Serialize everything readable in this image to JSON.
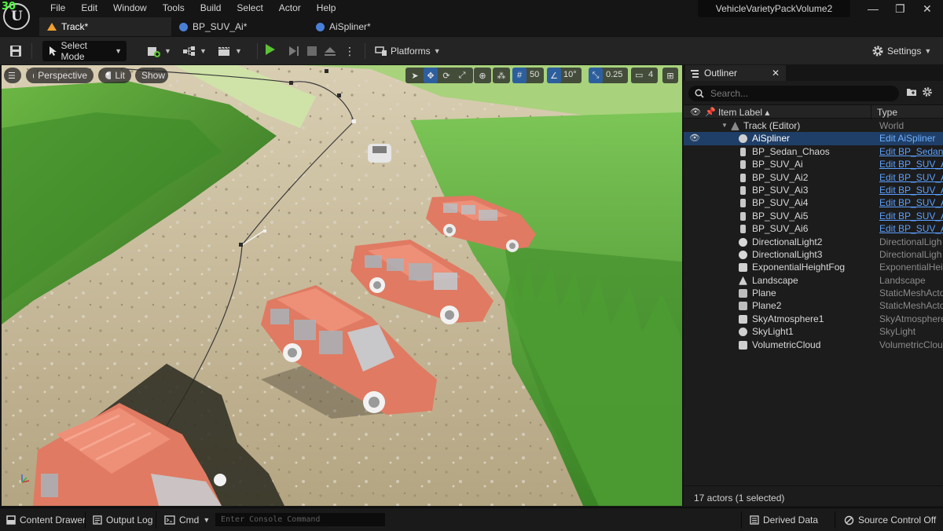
{
  "app": {
    "fps": "30",
    "project": "VehicleVarietyPackVolume2",
    "window_controls": {
      "minimize": "—",
      "maximize": "❐",
      "close": "✕"
    }
  },
  "menu": [
    "File",
    "Edit",
    "Window",
    "Tools",
    "Build",
    "Select",
    "Actor",
    "Help"
  ],
  "tabs": [
    {
      "label": "Track*",
      "icon": "level-icon",
      "active": true
    },
    {
      "label": "BP_SUV_Ai*",
      "icon": "blueprint-icon",
      "active": false
    },
    {
      "label": "AiSpliner*",
      "icon": "blueprint-icon",
      "active": false
    }
  ],
  "toolbar": {
    "select_mode": "Select Mode",
    "platforms": "Platforms",
    "settings": "Settings"
  },
  "viewport": {
    "perspective": "Perspective",
    "lit": "Lit",
    "show": "Show",
    "grid_snap": "50",
    "rotation_snap": "10°",
    "scale_snap": "0.25",
    "camera_speed": "4",
    "colors": {
      "grass": "#4e9a2e",
      "dirt": "#b9a888",
      "car": "#e07a62"
    }
  },
  "outliner": {
    "tab_label": "Outliner",
    "search_placeholder": "Search...",
    "col_label": "Item Label ▴",
    "col_type": "Type",
    "rows": [
      {
        "name": "Track (Editor)",
        "type": "World",
        "link": false,
        "icon": "world-icon",
        "level": 0,
        "selected": false,
        "eye": false
      },
      {
        "name": "AiSpliner",
        "type": "Edit AiSpliner",
        "link": true,
        "icon": "actor-icon",
        "level": 1,
        "selected": true,
        "eye": true
      },
      {
        "name": "BP_Sedan_Chaos",
        "type": "Edit BP_Sedan_",
        "link": true,
        "icon": "pawn-icon",
        "level": 1,
        "selected": false,
        "eye": false
      },
      {
        "name": "BP_SUV_Ai",
        "type": "Edit BP_SUV_A",
        "link": true,
        "icon": "pawn-icon",
        "level": 1,
        "selected": false,
        "eye": false
      },
      {
        "name": "BP_SUV_Ai2",
        "type": "Edit BP_SUV_A",
        "link": true,
        "icon": "pawn-icon",
        "level": 1,
        "selected": false,
        "eye": false
      },
      {
        "name": "BP_SUV_Ai3",
        "type": "Edit BP_SUV_A",
        "link": true,
        "icon": "pawn-icon",
        "level": 1,
        "selected": false,
        "eye": false
      },
      {
        "name": "BP_SUV_Ai4",
        "type": "Edit BP_SUV_A",
        "link": true,
        "icon": "pawn-icon",
        "level": 1,
        "selected": false,
        "eye": false
      },
      {
        "name": "BP_SUV_Ai5",
        "type": "Edit BP_SUV_A",
        "link": true,
        "icon": "pawn-icon",
        "level": 1,
        "selected": false,
        "eye": false
      },
      {
        "name": "BP_SUV_Ai6",
        "type": "Edit BP_SUV_A",
        "link": true,
        "icon": "pawn-icon",
        "level": 1,
        "selected": false,
        "eye": false
      },
      {
        "name": "DirectionalLight2",
        "type": "DirectionalLigh",
        "link": false,
        "icon": "sun-icon",
        "level": 1,
        "selected": false,
        "eye": false
      },
      {
        "name": "DirectionalLight3",
        "type": "DirectionalLigh",
        "link": false,
        "icon": "sun-icon",
        "level": 1,
        "selected": false,
        "eye": false
      },
      {
        "name": "ExponentialHeightFog",
        "type": "ExponentialHei",
        "link": false,
        "icon": "fog-icon",
        "level": 1,
        "selected": false,
        "eye": false
      },
      {
        "name": "Landscape",
        "type": "Landscape",
        "link": false,
        "icon": "landscape-icon",
        "level": 1,
        "selected": false,
        "eye": false
      },
      {
        "name": "Plane",
        "type": "StaticMeshActo",
        "link": false,
        "icon": "mesh-icon",
        "level": 1,
        "selected": false,
        "eye": false
      },
      {
        "name": "Plane2",
        "type": "StaticMeshActo",
        "link": false,
        "icon": "mesh-icon",
        "level": 1,
        "selected": false,
        "eye": false
      },
      {
        "name": "SkyAtmosphere1",
        "type": "SkyAtmosphere",
        "link": false,
        "icon": "sky-icon",
        "level": 1,
        "selected": false,
        "eye": false
      },
      {
        "name": "SkyLight1",
        "type": "SkyLight",
        "link": false,
        "icon": "skylight-icon",
        "level": 1,
        "selected": false,
        "eye": false
      },
      {
        "name": "VolumetricCloud",
        "type": "VolumetricClou",
        "link": false,
        "icon": "cloud-icon",
        "level": 1,
        "selected": false,
        "eye": false
      }
    ],
    "footer": "17 actors (1 selected)"
  },
  "statusbar": {
    "content_drawer": "Content Drawer",
    "output_log": "Output Log",
    "cmd": "Cmd",
    "console_placeholder": "Enter Console Command",
    "derived_data": "Derived Data",
    "source_control": "Source Control Off"
  }
}
